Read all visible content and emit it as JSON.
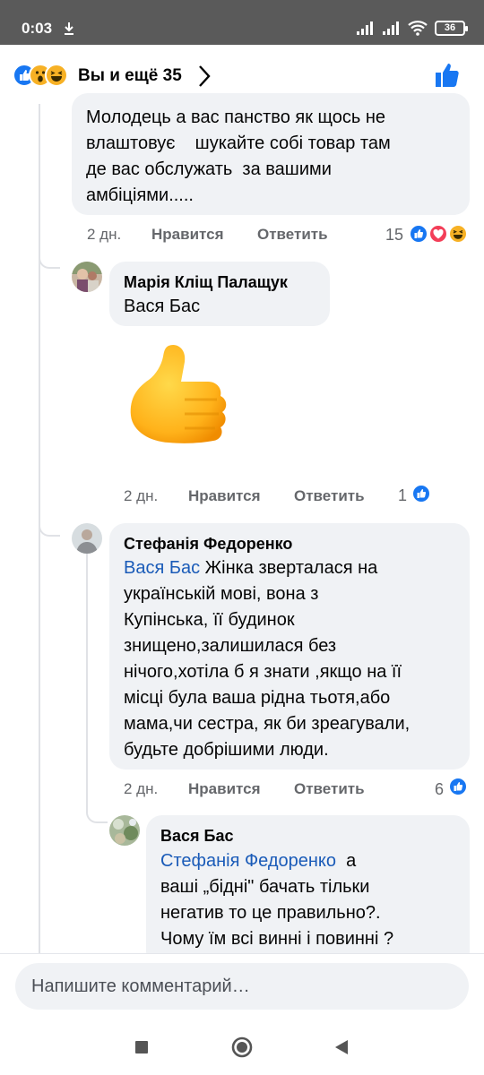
{
  "status_bar": {
    "time": "0:03",
    "download_icon": "download-icon",
    "battery": "36"
  },
  "header": {
    "reaction_icons": [
      "like-reaction-icon",
      "wow-reaction-icon",
      "haha-reaction-icon"
    ],
    "reactions_summary": "Вы и ещё 35",
    "chevron_icon": "chevron-right-icon",
    "like_icon": "thumbs-up-icon"
  },
  "comments": [
    {
      "text": "Молодець а вас панство як щось не\nвлаштовує    шукайте собі товар там\nде вас обслужать  за вашими\nамбіціями.....",
      "age": "2 дн.",
      "like_label": "Нравится",
      "reply_label": "Ответить",
      "reaction_count": "15",
      "reactions": [
        "like",
        "love",
        "haha"
      ]
    },
    {
      "author": "Марія Кліщ Палащук",
      "mention": "Вася Бас",
      "sticker": "thumbs-up-sticker",
      "age": "2 дн.",
      "like_label": "Нравится",
      "reply_label": "Ответить",
      "reaction_count": "1",
      "reactions": [
        "like"
      ]
    },
    {
      "author": "Стефанія Федоренко",
      "mention": "Вася Бас",
      "text_first": " Жінка зверталася на",
      "text_rest": "українській мові, вона з\nКупінська, її будинок\nзнищено,залишилася без\nнічого,хотіла б я знати ,якщо на її\nмісці була ваша рідна тьотя,або\nмама,чи сестра, як би зреагували,\nбудьте добрішими люди.",
      "age": "2 дн.",
      "like_label": "Нравится",
      "reply_label": "Ответить",
      "reaction_count": "6",
      "reactions": [
        "like"
      ]
    },
    {
      "author": "Вася Бас",
      "mention": "Стефанія Федоренко",
      "text_first": "  а",
      "text_rest": "ваші „бідні\" бачать тільки\nнегатив то це правильно?.\nЧому їм всі винні і повинні ?"
    }
  ],
  "composer": {
    "placeholder": "Напишите комментарий…"
  },
  "nav": {
    "icons": [
      "recents-square-icon",
      "home-circle-icon",
      "back-triangle-icon"
    ]
  },
  "colors": {
    "facebook_blue": "#1877f2",
    "mention_blue": "#1a5bb8",
    "bubble_bg": "#f0f2f5",
    "meta_gray": "#65676b"
  }
}
